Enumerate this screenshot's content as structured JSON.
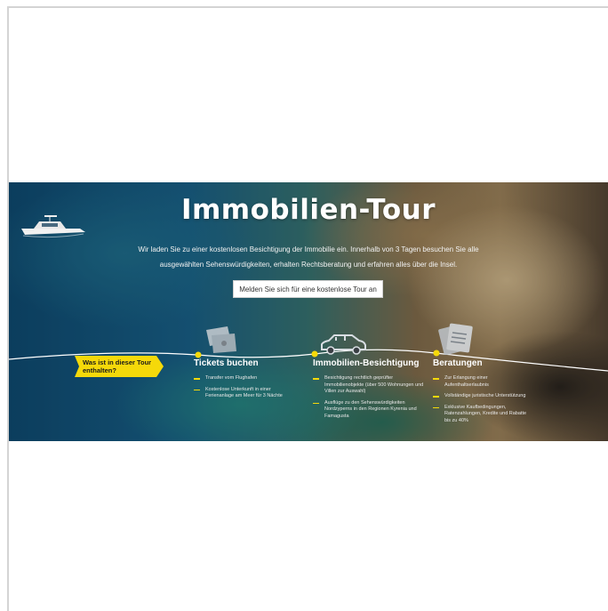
{
  "hero": {
    "title": "Immobilien-Tour",
    "description": "Wir laden Sie zu einer kostenlosen Besichtigung der Immobilie ein. Innerhalb von 3 Tagen besuchen Sie alle ausgewählten Sehenswürdigkeiten, erhalten Rechtsberatung und erfahren alles über die Insel.",
    "cta_label": "Melden Sie sich für eine kostenlose Tour an"
  },
  "tour": {
    "tag_label": "Was ist in dieser Tour enthalten?",
    "accent_color": "#f5d90a",
    "columns": [
      {
        "title": "Tickets buchen",
        "icon": "tickets-icon",
        "bullets": [
          "Transfer vom Flughafen",
          "Kostenlose Unterkunft in einer Ferienanlage am Meer für 3 Nächte"
        ]
      },
      {
        "title": "Immobilien-Besichtigung",
        "icon": "car-icon",
        "bullets": [
          "Besichtigung rechtlich geprüfter Immobilienobjekte (über 500 Wohnungen und Villen zur Auswahl)",
          "Ausflüge zu den Sehenswürdigkeiten Nordzyperns in den Regionen Kyrenia und Famagusta"
        ]
      },
      {
        "title": "Beratungen",
        "icon": "documents-icon",
        "bullets": [
          "Zur Erlangung einer Aufenthaltserlaubnis",
          "Vollständige juristische Unterstützung",
          "Exklusive Kaufbedingungen, Ratenzahlungen, Kredite und Rabatte bis zu 40%"
        ]
      }
    ]
  }
}
